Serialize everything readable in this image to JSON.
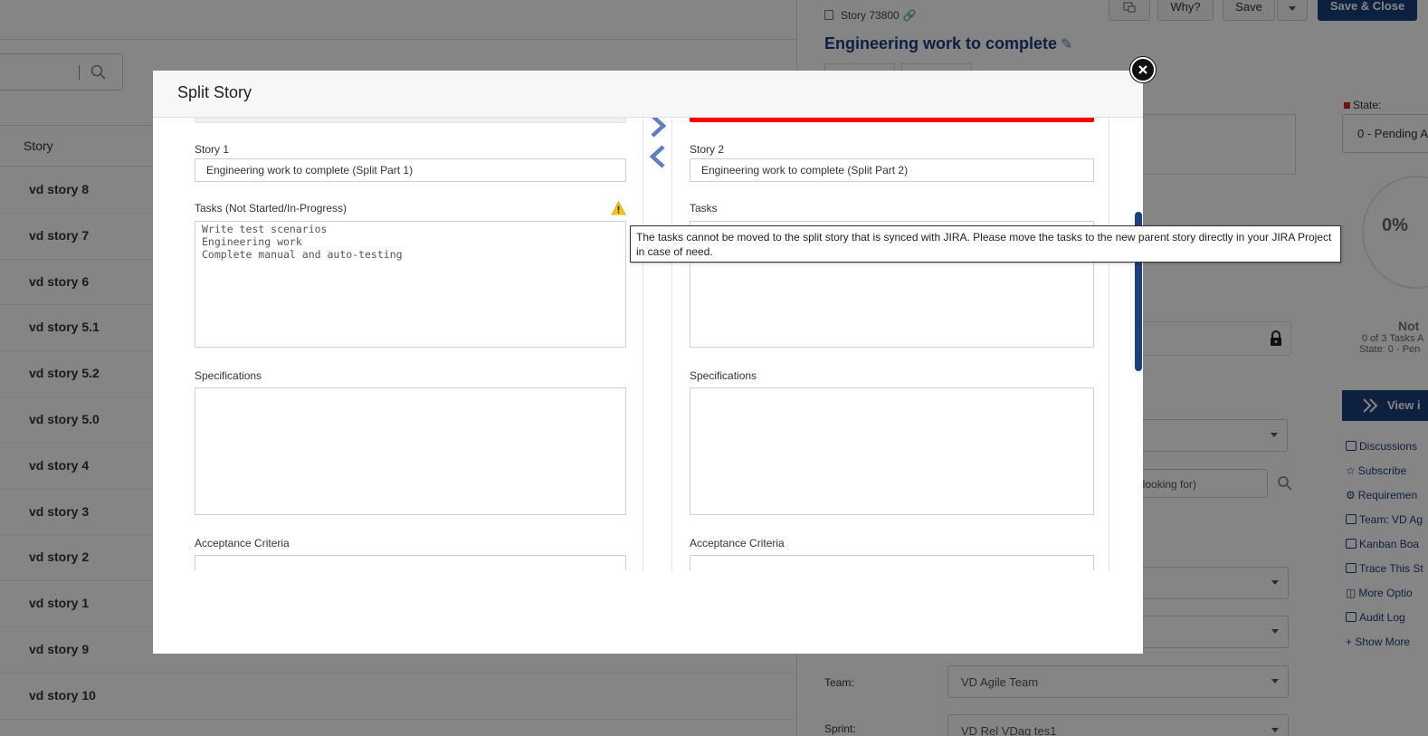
{
  "background": {
    "search": {
      "icon": "search-icon"
    },
    "list_header": "Story",
    "stories": [
      "vd story 8",
      "vd story 7",
      "vd story 6",
      "vd story 5.1",
      "vd story 5.2",
      "vd story 5.0",
      "vd story 4",
      "vd story 3",
      "vd story 2",
      "vd story 1",
      "vd story 9",
      "vd story 10"
    ]
  },
  "detail": {
    "story_id": "Story 73800",
    "title": "Engineering work to complete",
    "buttons": {
      "why": "Why?",
      "save": "Save",
      "save_close": "Save & Close"
    },
    "state_label": "State:",
    "state_value": "0 - Pending A",
    "progress_value": "0%",
    "progress_status": "Not",
    "progress_tasks": "0 of 3 Tasks A",
    "progress_state": "State: 0 - Pen",
    "view_button": "View i",
    "search_placeholder": "are looking for)",
    "links": [
      "Discussions",
      "Subscribe",
      "Requiremen",
      "Team: VD Ag",
      "Kanban Boa",
      "Trace This St",
      "More Optio",
      "Audit Log",
      "+ Show More"
    ],
    "team_label": "Team:",
    "team_value": "VD Agile Team",
    "sprint_label": "Sprint:",
    "sprint_value": "VD Rel VDag tes1"
  },
  "modal": {
    "title": "Split Story",
    "left": {
      "story_label": "Story 1",
      "story_value": "Engineering work to complete (Split Part 1)",
      "tasks_label": "Tasks (Not Started/In-Progress)",
      "tasks": [
        "Write test scenarios",
        "Engineering work",
        "Complete manual and auto-testing"
      ],
      "specs_label": "Specifications",
      "acceptance_label": "Acceptance Criteria"
    },
    "right": {
      "story_label": "Story 2",
      "story_value": "Engineering work to complete (Split Part 2)",
      "tasks_label": "Tasks",
      "specs_label": "Specifications",
      "acceptance_label": "Acceptance Criteria"
    },
    "tooltip": "The tasks cannot be moved to the split story that is synced with JIRA. Please move the tasks to the new parent story directly in your JIRA Project in case of need."
  },
  "colors": {
    "brand": "#1c3f7c",
    "arrow": "#5d7fc0",
    "warning": "#f5c518",
    "error_bar": "#ff0000"
  }
}
